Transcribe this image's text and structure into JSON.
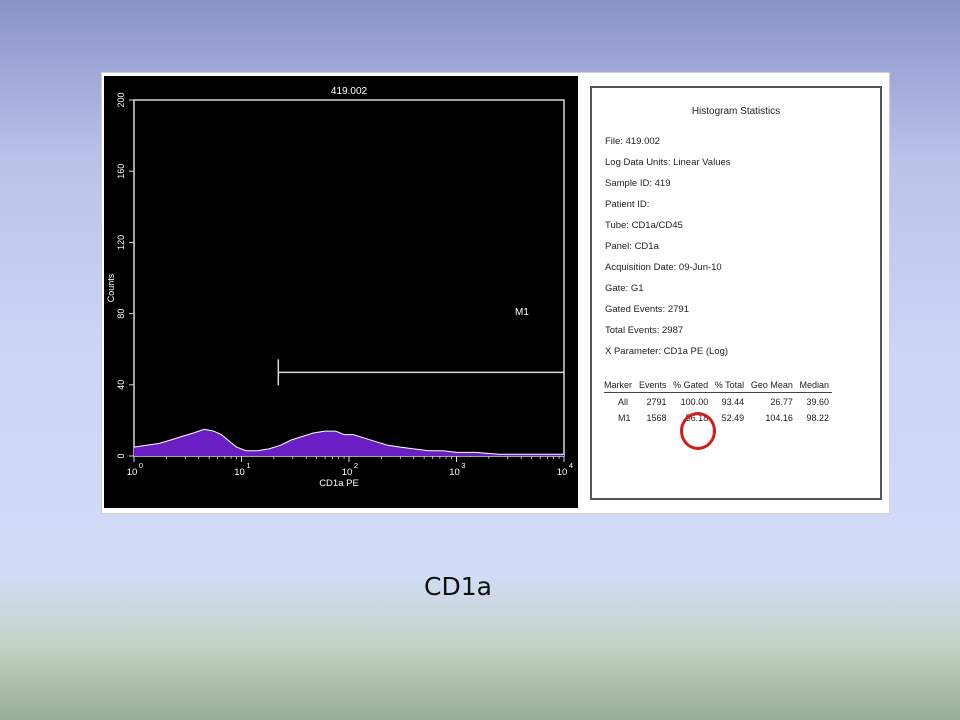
{
  "caption": "CD1a",
  "colors": {
    "histogram_fill": "#6a1fc4",
    "histogram_outline": "#ffffff",
    "plot_background": "#000000",
    "highlight_circle": "#d41a1a"
  },
  "chart_data": {
    "type": "area",
    "title": "419.002",
    "xlabel": "CD1a PE",
    "ylabel": "Counts",
    "xscale": "log",
    "xlim": [
      1,
      10000
    ],
    "ylim": [
      0,
      200
    ],
    "x_ticks": [
      {
        "base": "10",
        "exp": "0"
      },
      {
        "base": "10",
        "exp": "1"
      },
      {
        "base": "10",
        "exp": "2"
      },
      {
        "base": "10",
        "exp": "3"
      },
      {
        "base": "10",
        "exp": "4"
      }
    ],
    "y_ticks": [
      "0",
      "40",
      "80",
      "120",
      "160",
      "200"
    ],
    "series": [
      {
        "x": [
          1,
          1.3,
          1.7,
          2.2,
          2.8,
          3.6,
          4.5,
          5.5,
          6.5,
          7.8,
          9,
          11,
          14,
          18,
          23,
          29,
          37,
          47,
          60,
          75,
          90,
          110,
          140,
          180,
          230,
          300,
          400,
          550,
          750,
          1000,
          1500,
          2500,
          4000,
          7000,
          10000
        ],
        "values": [
          5,
          6,
          7,
          9,
          11,
          13,
          15,
          14,
          12,
          8,
          5,
          3,
          3,
          4,
          6,
          9,
          11,
          13,
          14,
          14,
          12,
          12,
          10,
          8,
          6,
          5,
          4,
          3,
          3,
          2,
          2,
          1,
          1,
          1,
          1
        ]
      }
    ],
    "marker": {
      "label": "M1",
      "x_start": 22,
      "x_end": 10000,
      "y": 47
    }
  },
  "stats": {
    "title": "Histogram Statistics",
    "lines": [
      "File: 419.002",
      "Log Data Units: Linear Values",
      "Sample ID: 419",
      "Patient ID:",
      "Tube: CD1a/CD45",
      "Panel: CD1a",
      "Acquisition Date: 09-Jun-10",
      "Gate: G1",
      "Gated Events: 2791",
      "Total Events: 2987",
      "X Parameter: CD1a PE (Log)"
    ],
    "table": {
      "headers": [
        "Marker",
        "Events",
        "% Gated",
        "% Total",
        "Geo Mean",
        "Median"
      ],
      "rows": [
        [
          "All",
          "2791",
          "100.00",
          "93.44",
          "26.77",
          "39.60"
        ],
        [
          "M1",
          "1568",
          "56.18",
          "52.49",
          "104.16",
          "98.22"
        ]
      ]
    }
  }
}
